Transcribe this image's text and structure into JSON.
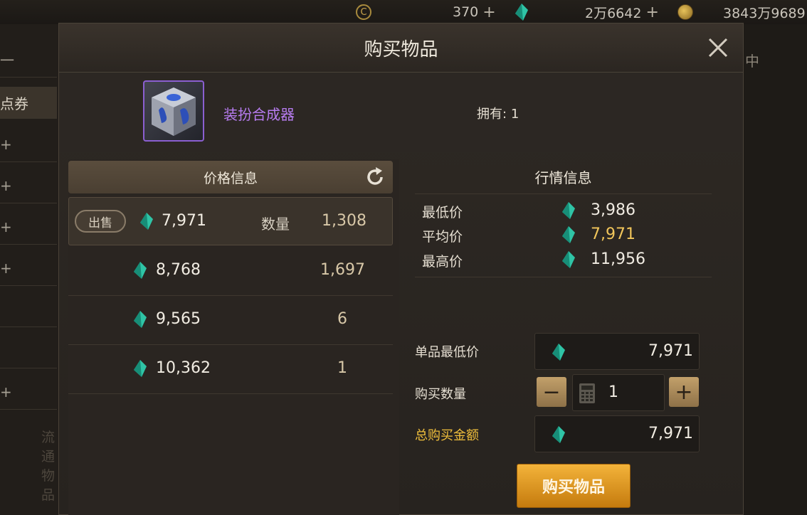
{
  "topbar": {
    "currency1_value": "370",
    "currency2_value": "2万6642",
    "currency3_value": "3843万9689",
    "plus_glyph": "+"
  },
  "background": {
    "left_items": [
      "一",
      "点券",
      "+",
      "+",
      "+",
      "+",
      "",
      "",
      "+"
    ],
    "right_label": "中",
    "faint_text_1": "流通物品"
  },
  "dialog": {
    "title": "购买物品",
    "close_glyph": "✕",
    "item": {
      "name": "装扮合成器",
      "owned_label": "拥有:",
      "owned_value": "1"
    },
    "price_info": {
      "header": "价格信息",
      "sell_button": "出售",
      "quantity_label": "数量",
      "rows": [
        {
          "price": "7,971",
          "quantity": "1,308"
        },
        {
          "price": "8,768",
          "quantity": "1,697"
        },
        {
          "price": "9,565",
          "quantity": "6"
        },
        {
          "price": "10,362",
          "quantity": "1"
        }
      ]
    },
    "market_info": {
      "header": "行情信息",
      "lowest_label": "最低价",
      "lowest_value": "3,986",
      "average_label": "平均价",
      "average_value": "7,971",
      "highest_label": "最高价",
      "highest_value": "11,956"
    },
    "purchase": {
      "unit_price_label": "单品最低价",
      "unit_price_value": "7,971",
      "quantity_label": "购买数量",
      "quantity_value": "1",
      "minus_glyph": "−",
      "plus_glyph": "+",
      "total_label": "总购买金额",
      "total_value": "7,971",
      "buy_button": "购买物品"
    }
  },
  "colors": {
    "gem": "#2fc4a6",
    "item_name": "#b77cf0",
    "average_price": "#f2c65b",
    "total_label": "#f0bf3c",
    "buy_button": "#e59a22"
  }
}
